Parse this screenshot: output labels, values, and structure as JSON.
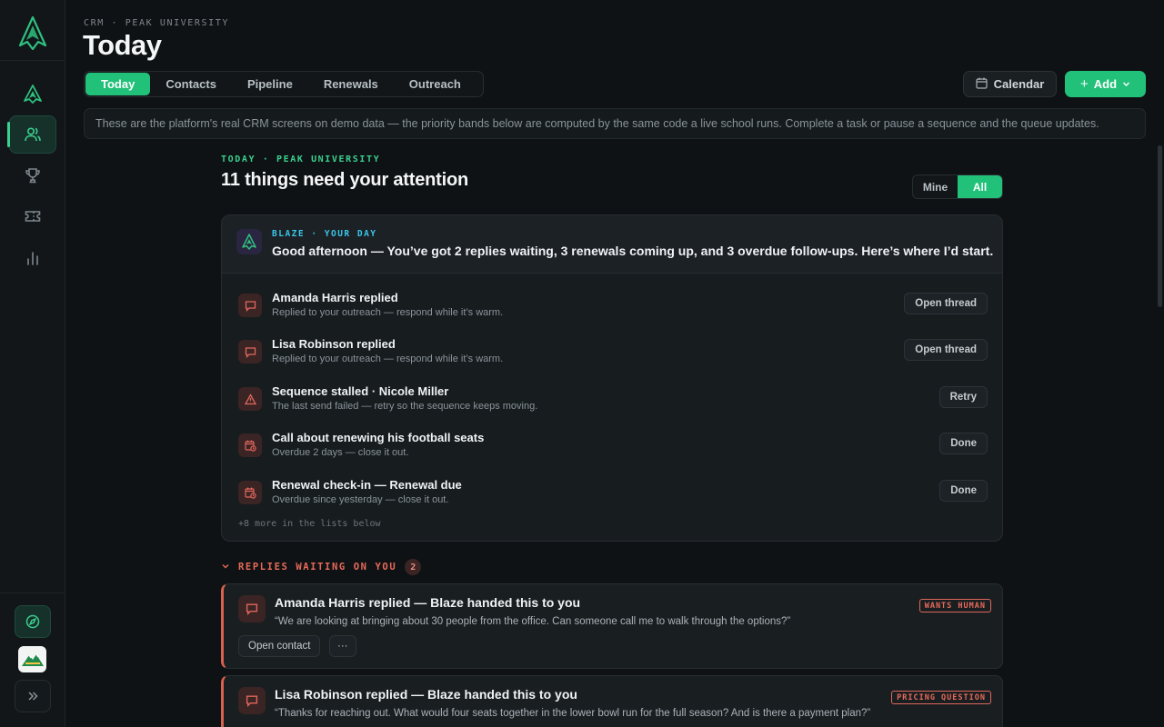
{
  "header": {
    "breadcrumb": "CRM · PEAK UNIVERSITY",
    "title": "Today",
    "tabs": [
      {
        "label": "Today",
        "active": true
      },
      {
        "label": "Contacts",
        "active": false
      },
      {
        "label": "Pipeline",
        "active": false
      },
      {
        "label": "Renewals",
        "active": false
      },
      {
        "label": "Outreach",
        "active": false
      }
    ],
    "calendar_label": "Calendar",
    "add_label": "Add",
    "banner": "These are the platform's real CRM screens on demo data — the priority bands below are computed by the same code a live school runs. Complete a task or pause a sequence and the queue updates."
  },
  "sidebar": {
    "icons": [
      "logo-icon",
      "home-icon",
      "contacts-icon",
      "trophy-icon",
      "ticket-icon",
      "chart-icon"
    ],
    "active": "contacts-icon",
    "bottom": [
      "compass-icon",
      "school-logo",
      "expand-icon"
    ]
  },
  "main": {
    "eyebrow": "TODAY · PEAK UNIVERSITY",
    "headline": "11 things need your attention",
    "toggle": {
      "mine": "Mine",
      "all": "All",
      "selected": "All"
    },
    "blaze": {
      "eyebrow": "BLAZE · YOUR DAY",
      "message": "Good afternoon — You’ve got 2 replies waiting, 3 renewals coming up, and 3 overdue follow-ups. Here’s where I’d start."
    },
    "tasks": [
      {
        "icon": "chat-icon",
        "title": "Amanda Harris replied",
        "sub": "Replied to your outreach — respond while it’s warm.",
        "action": "Open thread"
      },
      {
        "icon": "chat-icon",
        "title": "Lisa Robinson replied",
        "sub": "Replied to your outreach — respond while it’s warm.",
        "action": "Open thread"
      },
      {
        "icon": "warning-icon",
        "title": "Sequence stalled · Nicole Miller",
        "sub": "The last send failed — retry so the sequence keeps moving.",
        "action": "Retry"
      },
      {
        "icon": "calendar-clock-icon",
        "title": "Call about renewing his football seats",
        "sub": "Overdue 2 days — close it out.",
        "action": "Done"
      },
      {
        "icon": "calendar-clock-icon",
        "title": "Renewal check-in — Renewal due",
        "sub": "Overdue since yesterday — close it out.",
        "action": "Done"
      }
    ],
    "more_note": "+8 more in the lists below",
    "replies_section": {
      "label": "REPLIES WAITING ON YOU",
      "count": "2",
      "items": [
        {
          "title": "Amanda Harris replied — Blaze handed this to you",
          "quote": "“We are looking at bringing about 30 people from the office. Can someone call me to walk through the options?”",
          "tag": "WANTS HUMAN",
          "primary_action": "Open contact",
          "more": "···"
        },
        {
          "title": "Lisa Robinson replied — Blaze handed this to you",
          "quote": "“Thanks for reaching out. What would four seats together in the lower bowl run for the full season? And is there a payment plan?”",
          "tag": "PRICING QUESTION"
        }
      ]
    }
  },
  "colors": {
    "accent": "#22c17a",
    "alert": "#e0675c",
    "blaze": "#39c6e8",
    "background": "#0f1214"
  }
}
